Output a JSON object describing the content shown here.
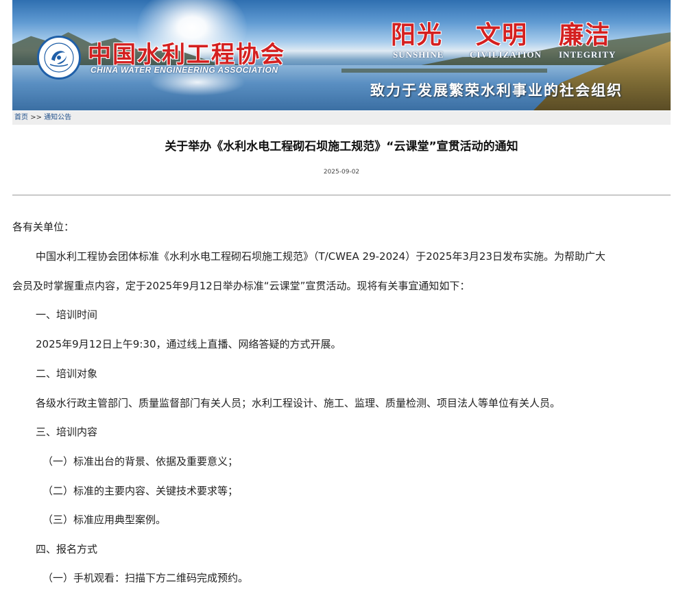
{
  "header": {
    "logo_cn": "中国水利工程协会",
    "logo_en": "CHINA WATER ENGINEERING ASSOCIATION",
    "slogans": [
      {
        "cn": "阳光",
        "en": "SUNSHINE"
      },
      {
        "cn": "文明",
        "en": "CIVILIZATION"
      },
      {
        "cn": "廉洁",
        "en": "INTEGRITY"
      }
    ],
    "motto": "致力于发展繁荣水利事业的社会组织"
  },
  "breadcrumb": {
    "home": "首页",
    "separator": ">>",
    "current": "通知公告"
  },
  "article": {
    "title": "关于举办《水利水电工程砌石坝施工规范》“云课堂”宣贯活动的通知",
    "date": "2025-09-02",
    "salutation": "各有关单位：",
    "intro_line1": "中国水利工程协会团体标准《水利水电工程砌石坝施工规范》（T/CWEA 29-2024）于2025年3月23日发布实施。为帮助广大",
    "intro_line2": "会员及时掌握重点内容，定于2025年9月12日举办标准“云课堂”宣贯活动。现将有关事宜通知如下：",
    "s1_heading": "一、培训时间",
    "s1_text": "2025年9月12日上午9:30，通过线上直播、网络答疑的方式开展。",
    "s2_heading": "二、培训对象",
    "s2_text": "各级水行政主管部门、质量监督部门有关人员；水利工程设计、施工、监理、质量检测、项目法人等单位有关人员。",
    "s3_heading": "三、培训内容",
    "s3_items": [
      "（一）标准出台的背景、依据及重要意义；",
      "（二）标准的主要内容、关键技术要求等；",
      "（三）标准应用典型案例。"
    ],
    "s4_heading": "四、报名方式",
    "s4_item1": "（一）手机观看：扫描下方二维码完成预约。"
  },
  "colors": {
    "brand_red": "#d42020",
    "brand_blue": "#1f5fa8",
    "link": "#1f4f8a"
  }
}
